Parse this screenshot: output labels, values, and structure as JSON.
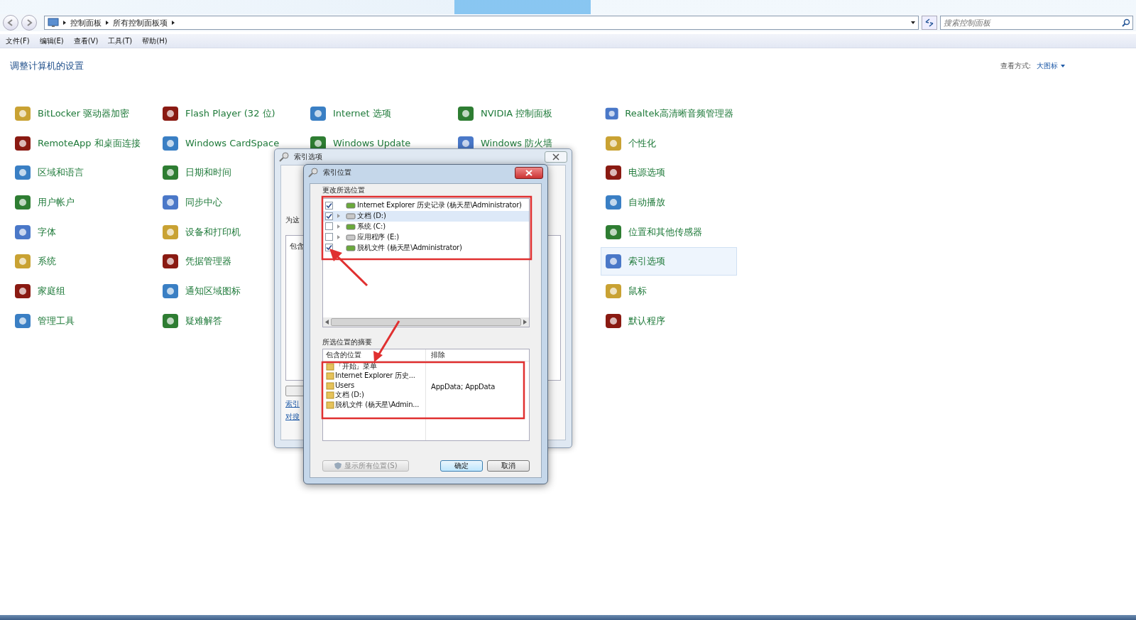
{
  "address": {
    "crumbs": [
      "控制面板",
      "所有控制面板项"
    ]
  },
  "search": {
    "placeholder": "搜索控制面板"
  },
  "menu": [
    "文件(F)",
    "编辑(E)",
    "查看(V)",
    "工具(T)",
    "帮助(H)"
  ],
  "heading": "调整计算机的设置",
  "view": {
    "label": "查看方式:",
    "value": "大图标"
  },
  "columns": [
    [
      {
        "label": "BitLocker 驱动器加密",
        "selected": false
      },
      {
        "label": "RemoteApp 和桌面连接",
        "selected": false
      },
      {
        "label": "区域和语言",
        "selected": false
      },
      {
        "label": "用户帐户",
        "selected": false
      },
      {
        "label": "字体",
        "selected": false
      },
      {
        "label": "系统",
        "selected": false
      },
      {
        "label": "家庭组",
        "selected": false
      },
      {
        "label": "管理工具",
        "selected": false
      }
    ],
    [
      {
        "label": "Flash Player (32 位)",
        "selected": false
      },
      {
        "label": "Windows CardSpace",
        "selected": false
      },
      {
        "label": "日期和时间",
        "selected": false
      },
      {
        "label": "同步中心",
        "selected": false
      },
      {
        "label": "设备和打印机",
        "selected": false
      },
      {
        "label": "凭据管理器",
        "selected": false
      },
      {
        "label": "通知区域图标",
        "selected": false
      },
      {
        "label": "疑难解答",
        "selected": false
      }
    ],
    [
      {
        "label": "Internet 选项",
        "selected": false
      },
      {
        "label": "Windows Update",
        "selected": false
      }
    ],
    [
      {
        "label": "NVIDIA 控制面板",
        "selected": false
      },
      {
        "label": "Windows 防火墙",
        "selected": false
      }
    ],
    [
      {
        "label": "Realtek高清晰音频管理器",
        "selected": false
      },
      {
        "label": "个性化",
        "selected": false
      },
      {
        "label": "电源选项",
        "selected": false
      },
      {
        "label": "自动播放",
        "selected": false
      },
      {
        "label": "位置和其他传感器",
        "selected": false
      },
      {
        "label": "索引选项",
        "selected": true
      },
      {
        "label": "鼠标",
        "selected": false
      },
      {
        "label": "默认程序",
        "selected": false
      }
    ]
  ],
  "back_dialog": {
    "title": "索引选项",
    "fragments": [
      "为这",
      "包含"
    ],
    "links": [
      "索引",
      "对搜"
    ]
  },
  "dialog": {
    "title": "索引位置",
    "locations_label": "更改所选位置",
    "locations": [
      {
        "label": "Internet Explorer 历史记录 (杨天星\\Administrator)",
        "checked": true,
        "expandable": false,
        "selected": false
      },
      {
        "label": "文档 (D:)",
        "checked": true,
        "expandable": true,
        "selected": true
      },
      {
        "label": "系统 (C:)",
        "checked": false,
        "expandable": true,
        "selected": false
      },
      {
        "label": "应用程序 (E:)",
        "checked": false,
        "expandable": true,
        "selected": false
      },
      {
        "label": "脱机文件 (杨天星\\Administrator)",
        "checked": true,
        "expandable": false,
        "selected": false
      }
    ],
    "summary_label": "所选位置的摘要",
    "summary_columns": [
      "包含的位置",
      "排除"
    ],
    "summary_rows": [
      {
        "location": "「开始」菜单",
        "exclude": ""
      },
      {
        "location": "Internet Explorer 历史...",
        "exclude": ""
      },
      {
        "location": "Users",
        "exclude": "AppData; AppData"
      },
      {
        "location": "文档 (D:)",
        "exclude": ""
      },
      {
        "location": "脱机文件 (杨天星\\Admin...",
        "exclude": ""
      }
    ],
    "buttons": [
      {
        "label": "显示所有位置(S)",
        "kind": "shield",
        "disabled": true
      },
      {
        "label": "确定",
        "kind": "default",
        "disabled": false
      },
      {
        "label": "取消",
        "kind": "normal",
        "disabled": false
      }
    ]
  }
}
